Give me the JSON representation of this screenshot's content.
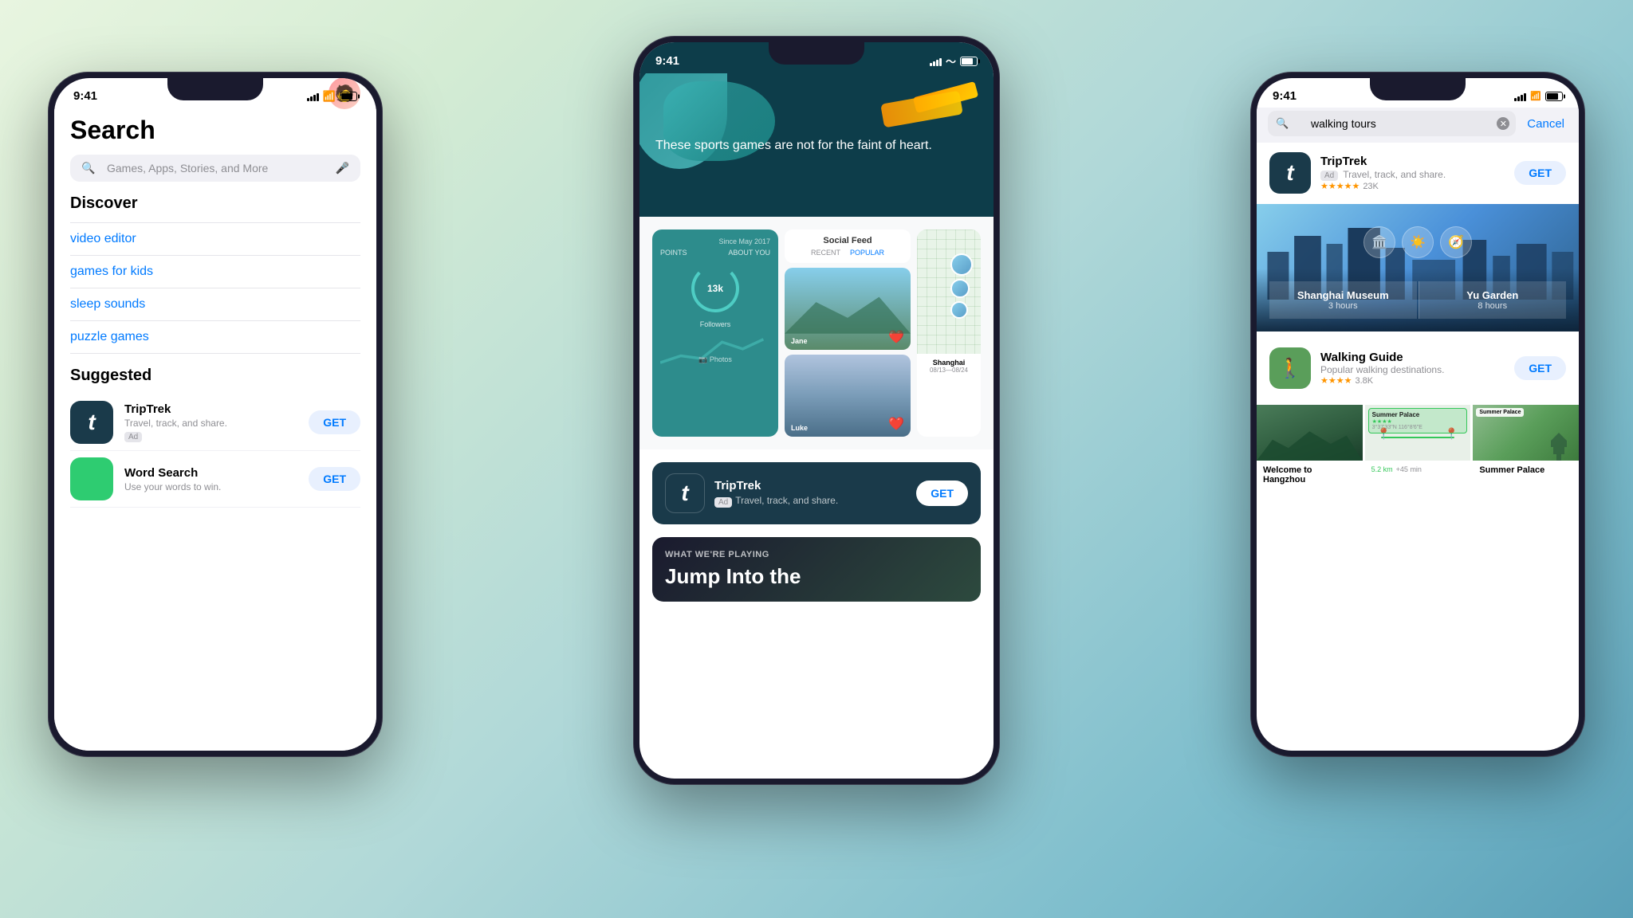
{
  "background": {
    "gradient": "linear-gradient(135deg, #e8f5e0, #d4ecd4, #b0d8d8, #7bbccc, #5aa0b8)"
  },
  "left_phone": {
    "status": {
      "time": "9:41",
      "signal": "●●●●",
      "wifi": "wifi",
      "battery": "battery"
    },
    "screen": "search",
    "title": "Search",
    "search_placeholder": "Games, Apps, Stories, and More",
    "sections": {
      "discover": {
        "title": "Discover",
        "items": [
          "video editor",
          "games for kids",
          "sleep sounds",
          "puzzle games"
        ]
      },
      "suggested": {
        "title": "Suggested",
        "apps": [
          {
            "name": "TripTrek",
            "desc": "Travel, track, and share.",
            "ad": "Ad",
            "action": "GET"
          },
          {
            "name": "Word Search",
            "desc": "Use your words to win.",
            "action": "GET"
          }
        ]
      }
    }
  },
  "center_phone": {
    "status": {
      "time": "9:41"
    },
    "banner": {
      "text": "These sports games are not for the faint of heart."
    },
    "app_ad": {
      "name": "TripTrek",
      "badge": "Ad",
      "desc": "Travel, track, and share.",
      "action": "GET"
    },
    "what_playing": {
      "label": "WHAT WE'RE PLAYING",
      "title": "Jump Into the"
    },
    "social_feed": {
      "title": "Social Feed",
      "followers": "13k",
      "locations": [
        "Jane",
        "Luke"
      ],
      "map_location": "Shanghai"
    }
  },
  "right_phone": {
    "status": {
      "time": "9:41"
    },
    "search_query": "walking tours",
    "cancel_label": "Cancel",
    "results": [
      {
        "name": "TripTrek",
        "desc": "Travel, track, and share.",
        "badge": "Ad",
        "rating": "★★★★★",
        "review_count": "23K",
        "action": "GET"
      },
      {
        "name": "Walking Guide",
        "desc": "Popular walking destinations.",
        "rating": "★★★★",
        "review_count": "3.8K",
        "action": "GET"
      }
    ],
    "feature": {
      "city_image_alt": "Shanghai skyline",
      "locations": [
        {
          "name": "Shanghai Museum",
          "hours": "3 hours"
        },
        {
          "name": "Yu Garden",
          "hours": "8 hours"
        }
      ]
    },
    "summer_palace_cards": [
      {
        "title": "Welcome to Hangzhou",
        "type": "photo"
      },
      {
        "title": "Summer Palace",
        "subtitle": "3°37'33\"N 116°8'6\"E",
        "type": "map-green"
      },
      {
        "title": "Summer Palace",
        "type": "map-satellite"
      }
    ]
  }
}
